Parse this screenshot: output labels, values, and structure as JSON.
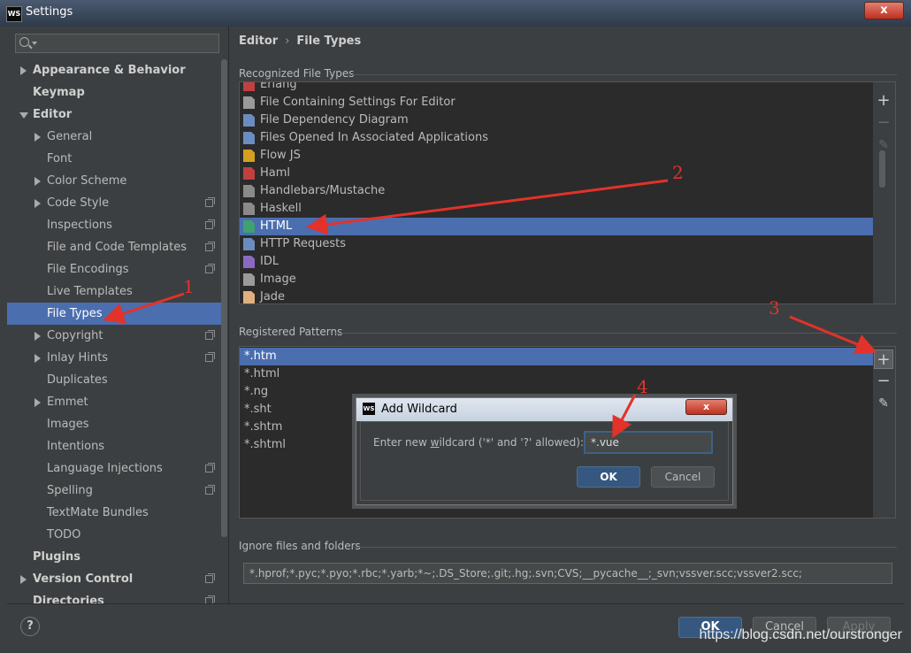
{
  "window": {
    "title": "Settings",
    "app_icon": "WS",
    "close_label": "x"
  },
  "search": {
    "placeholder": ""
  },
  "tree": [
    {
      "label": "Appearance & Behavior",
      "level": 0,
      "bold": true,
      "arrow": "right"
    },
    {
      "label": "Keymap",
      "level": 0,
      "bold": true,
      "arrow": ""
    },
    {
      "label": "Editor",
      "level": 0,
      "bold": true,
      "arrow": "down"
    },
    {
      "label": "General",
      "level": 1,
      "arrow": "right"
    },
    {
      "label": "Font",
      "level": 1,
      "arrow": ""
    },
    {
      "label": "Color Scheme",
      "level": 1,
      "arrow": "right"
    },
    {
      "label": "Code Style",
      "level": 1,
      "arrow": "right",
      "copy": true
    },
    {
      "label": "Inspections",
      "level": 1,
      "arrow": "",
      "copy": true
    },
    {
      "label": "File and Code Templates",
      "level": 1,
      "arrow": "",
      "copy": true
    },
    {
      "label": "File Encodings",
      "level": 1,
      "arrow": "",
      "copy": true
    },
    {
      "label": "Live Templates",
      "level": 1,
      "arrow": ""
    },
    {
      "label": "File Types",
      "level": 1,
      "arrow": "",
      "selected": true
    },
    {
      "label": "Copyright",
      "level": 1,
      "arrow": "right",
      "copy": true
    },
    {
      "label": "Inlay Hints",
      "level": 1,
      "arrow": "right",
      "copy": true
    },
    {
      "label": "Duplicates",
      "level": 1,
      "arrow": ""
    },
    {
      "label": "Emmet",
      "level": 1,
      "arrow": "right"
    },
    {
      "label": "Images",
      "level": 1,
      "arrow": ""
    },
    {
      "label": "Intentions",
      "level": 1,
      "arrow": ""
    },
    {
      "label": "Language Injections",
      "level": 1,
      "arrow": "",
      "copy": true
    },
    {
      "label": "Spelling",
      "level": 1,
      "arrow": "",
      "copy": true
    },
    {
      "label": "TextMate Bundles",
      "level": 1,
      "arrow": ""
    },
    {
      "label": "TODO",
      "level": 1,
      "arrow": ""
    },
    {
      "label": "Plugins",
      "level": 0,
      "bold": true,
      "arrow": ""
    },
    {
      "label": "Version Control",
      "level": 0,
      "bold": true,
      "arrow": "right",
      "copy": true
    },
    {
      "label": "Directories",
      "level": 0,
      "bold": true,
      "arrow": "",
      "copy": true
    }
  ],
  "breadcrumb": {
    "parent": "Editor",
    "separator": "›",
    "current": "File Types"
  },
  "recognized": {
    "title": "Recognized File Types",
    "items": [
      {
        "label": "Erlang",
        "icon": "erlang-icon",
        "color": "#c04040"
      },
      {
        "label": "File Containing Settings For Editor",
        "icon": "gear-icon",
        "color": "#9a9a9a"
      },
      {
        "label": "File Dependency Diagram",
        "icon": "diagram-icon",
        "color": "#6a8cc0"
      },
      {
        "label": "Files Opened In Associated Applications",
        "icon": "external-file-icon",
        "color": "#6a8cc0"
      },
      {
        "label": "Flow JS",
        "icon": "flow-js-icon",
        "color": "#d4a020"
      },
      {
        "label": "Haml",
        "icon": "haml-icon",
        "color": "#c04040"
      },
      {
        "label": "Handlebars/Mustache",
        "icon": "handlebars-icon",
        "color": "#8a8a8a"
      },
      {
        "label": "Haskell",
        "icon": "haskell-icon",
        "color": "#8a8a8a"
      },
      {
        "label": "HTML",
        "icon": "html-icon",
        "color": "#40a070",
        "selected": true
      },
      {
        "label": "HTTP Requests",
        "icon": "api-icon",
        "color": "#6a8cc0"
      },
      {
        "label": "IDL",
        "icon": "idl-icon",
        "color": "#8a6ac0"
      },
      {
        "label": "Image",
        "icon": "image-icon",
        "color": "#9a9a9a"
      },
      {
        "label": "Jade",
        "icon": "jade-icon",
        "color": "#e0b080"
      }
    ]
  },
  "patterns": {
    "title": "Registered Patterns",
    "items": [
      {
        "label": "*.htm",
        "selected": true
      },
      {
        "label": "*.html"
      },
      {
        "label": "*.ng"
      },
      {
        "label": "*.sht"
      },
      {
        "label": "*.shtm"
      },
      {
        "label": "*.shtml"
      }
    ]
  },
  "side_buttons": {
    "add": "+",
    "remove": "−",
    "edit": "✎"
  },
  "ignore": {
    "title": "Ignore files and folders",
    "value": "*.hprof;*.pyc;*.pyo;*.rbc;*.yarb;*~;.DS_Store;.git;.hg;.svn;CVS;__pycache__;_svn;vssver.scc;vssver2.scc;"
  },
  "dialog": {
    "title": "Add Wildcard",
    "icon": "WS",
    "close_label": "x",
    "prompt_before": "Enter new ",
    "prompt_underlined": "w",
    "prompt_after": "ildcard ('*' and '?' allowed):",
    "value": "*.vue",
    "ok": "OK",
    "cancel": "Cancel"
  },
  "footer": {
    "help": "?",
    "ok": "OK",
    "cancel": "Cancel",
    "apply": "Apply"
  },
  "annotations": [
    "1",
    "2",
    "3",
    "4"
  ],
  "watermark": "https://blog.csdn.net/ourstronger",
  "colors": {
    "selection": "#4b6eaf",
    "arrow": "#e2322a"
  }
}
